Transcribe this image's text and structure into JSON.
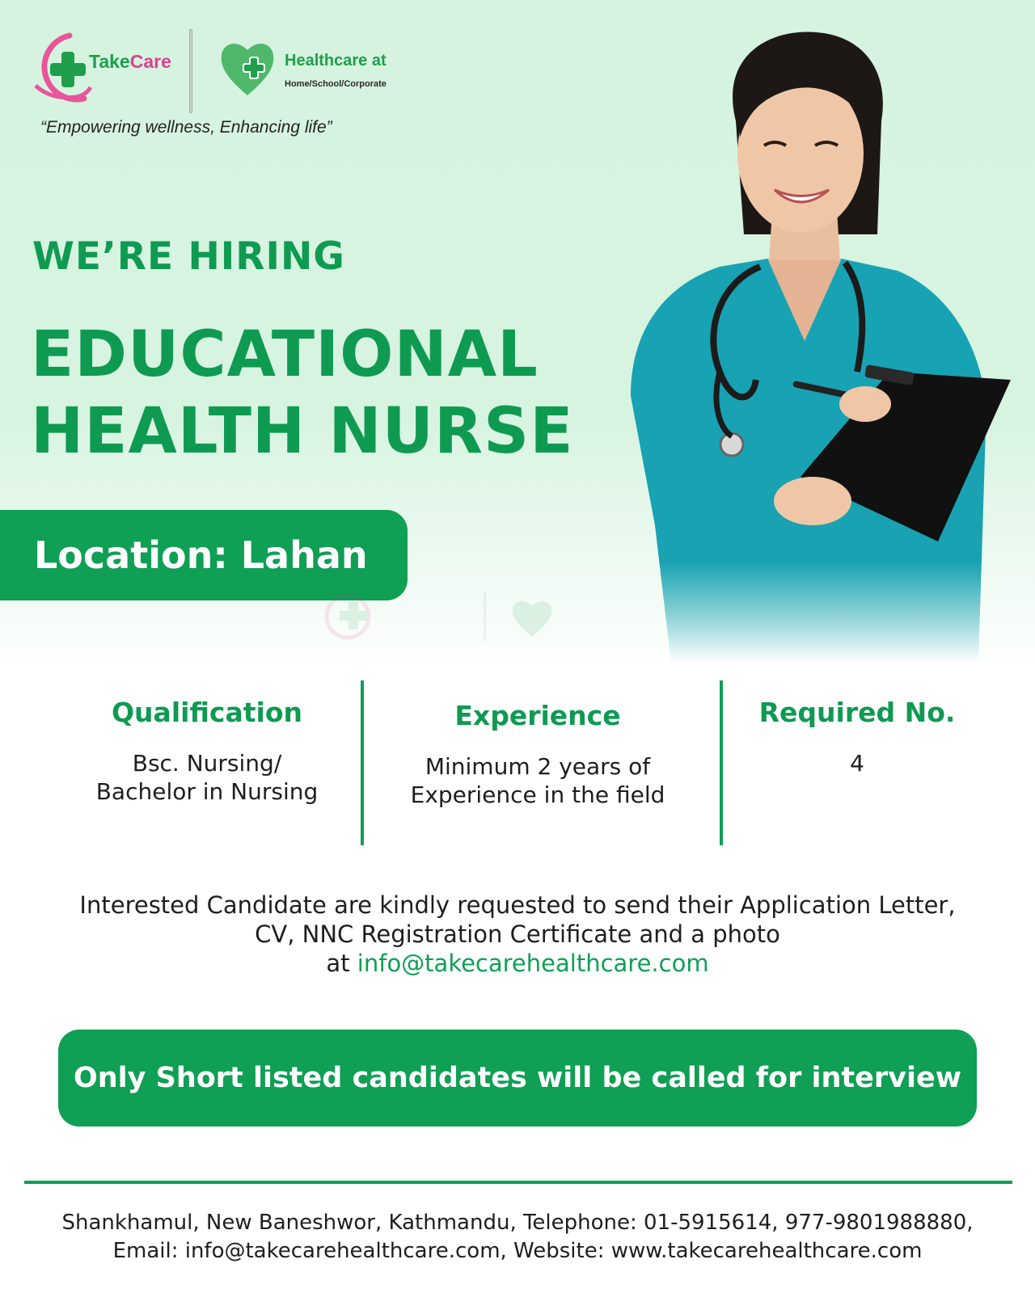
{
  "brand": {
    "takecare_part1": "Take",
    "takecare_part2": "Care",
    "healthcare_title": "Healthcare at",
    "healthcare_sub": "Home/School/Corporate",
    "tagline": "“Empowering wellness, Enhancing life”",
    "colors": {
      "green": "#0f9f55",
      "pink": "#d9438f",
      "mint": "#d6f3df"
    }
  },
  "headline": {
    "hiring": "WE’RE HIRING",
    "title_line1": "EDUCATIONAL",
    "title_line2": "HEALTH NURSE",
    "location": "Location: Lahan"
  },
  "details": {
    "qualification": {
      "heading": "Qualification",
      "line1": "Bsc. Nursing/",
      "line2": "Bachelor in Nursing"
    },
    "experience": {
      "heading": "Experience",
      "line1": "Minimum 2 years of",
      "line2": "Experience in the field"
    },
    "required": {
      "heading": "Required No.",
      "value": "4"
    }
  },
  "apply": {
    "line1": "Interested Candidate are kindly requested to send their Application Letter,",
    "line2": "CV, NNC Registration Certificate and a photo",
    "line3_prefix": "at",
    "email": "info@takecarehealthcare.com"
  },
  "cta": {
    "label": "Only Short listed candidates will be called for interview"
  },
  "footer": {
    "line1": "Shankhamul, New Baneshwor, Kathmandu, Telephone: 01-5915614, 977-9801988880,",
    "line2": "Email: info@takecarehealthcare.com, Website: www.takecarehealthcare.com"
  },
  "icons": [
    "takecare-logo-icon",
    "healthcare-heart-logo-icon",
    "nurse-illustration",
    "stethoscope-icon",
    "clipboard-icon"
  ]
}
